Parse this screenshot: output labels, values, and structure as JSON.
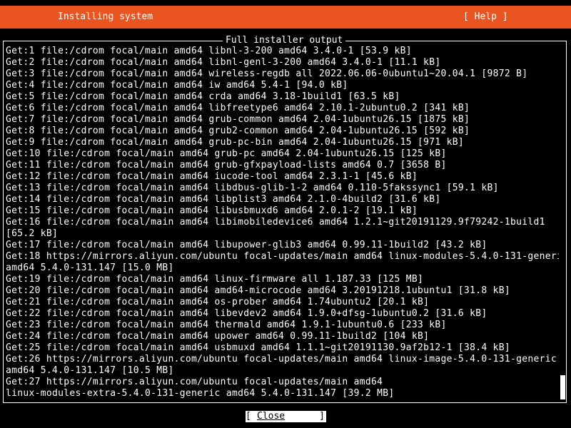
{
  "header": {
    "title": "Installing system",
    "help_label": "[ Help ]",
    "background": "#e95420"
  },
  "panel": {
    "title": "Full installer output",
    "lines": [
      "Get:1 file:/cdrom focal/main amd64 libnl-3-200 amd64 3.4.0-1 [53.9 kB]",
      "Get:2 file:/cdrom focal/main amd64 libnl-genl-3-200 amd64 3.4.0-1 [11.1 kB]",
      "Get:3 file:/cdrom focal/main amd64 wireless-regdb all 2022.06.06-0ubuntu1~20.04.1 [9872 B]",
      "Get:4 file:/cdrom focal/main amd64 iw amd64 5.4-1 [94.0 kB]",
      "Get:5 file:/cdrom focal/main amd64 crda amd64 3.18-1build1 [63.5 kB]",
      "Get:6 file:/cdrom focal/main amd64 libfreetype6 amd64 2.10.1-2ubuntu0.2 [341 kB]",
      "Get:7 file:/cdrom focal/main amd64 grub-common amd64 2.04-1ubuntu26.15 [1875 kB]",
      "Get:8 file:/cdrom focal/main amd64 grub2-common amd64 2.04-1ubuntu26.15 [592 kB]",
      "Get:9 file:/cdrom focal/main amd64 grub-pc-bin amd64 2.04-1ubuntu26.15 [971 kB]",
      "Get:10 file:/cdrom focal/main amd64 grub-pc amd64 2.04-1ubuntu26.15 [125 kB]",
      "Get:11 file:/cdrom focal/main amd64 grub-gfxpayload-lists amd64 0.7 [3658 B]",
      "Get:12 file:/cdrom focal/main amd64 iucode-tool amd64 2.3.1-1 [45.6 kB]",
      "Get:13 file:/cdrom focal/main amd64 libdbus-glib-1-2 amd64 0.110-5fakssync1 [59.1 kB]",
      "Get:14 file:/cdrom focal/main amd64 libplist3 amd64 2.1.0-4build2 [31.6 kB]",
      "Get:15 file:/cdrom focal/main amd64 libusbmuxd6 amd64 2.0.1-2 [19.1 kB]",
      "Get:16 file:/cdrom focal/main amd64 libimobiledevice6 amd64 1.2.1~git20191129.9f79242-1build1",
      "[65.2 kB]",
      "Get:17 file:/cdrom focal/main amd64 libupower-glib3 amd64 0.99.11-1build2 [43.2 kB]",
      "Get:18 https://mirrors.aliyun.com/ubuntu focal-updates/main amd64 linux-modules-5.4.0-131-generic",
      "amd64 5.4.0-131.147 [15.0 MB]",
      "Get:19 file:/cdrom focal/main amd64 linux-firmware all 1.187.33 [125 MB]",
      "Get:20 file:/cdrom focal/main amd64 amd64-microcode amd64 3.20191218.1ubuntu1 [31.8 kB]",
      "Get:21 file:/cdrom focal/main amd64 os-prober amd64 1.74ubuntu2 [20.1 kB]",
      "Get:22 file:/cdrom focal/main amd64 libevdev2 amd64 1.9.0+dfsg-1ubuntu0.2 [31.6 kB]",
      "Get:23 file:/cdrom focal/main amd64 thermald amd64 1.9.1-1ubuntu0.6 [233 kB]",
      "Get:24 file:/cdrom focal/main amd64 upower amd64 0.99.11-1build2 [104 kB]",
      "Get:25 file:/cdrom focal/main amd64 usbmuxd amd64 1.1.1~git20191130.9af2b12-1 [38.4 kB]",
      "Get:26 https://mirrors.aliyun.com/ubuntu focal-updates/main amd64 linux-image-5.4.0-131-generic",
      "amd64 5.4.0-131.147 [10.5 MB]",
      "Get:27 https://mirrors.aliyun.com/ubuntu focal-updates/main amd64",
      "linux-modules-extra-5.4.0-131-generic amd64 5.4.0-131.147 [39.2 MB]"
    ]
  },
  "footer": {
    "close_open": "[",
    "close_label": "Close",
    "close_close": "]"
  }
}
